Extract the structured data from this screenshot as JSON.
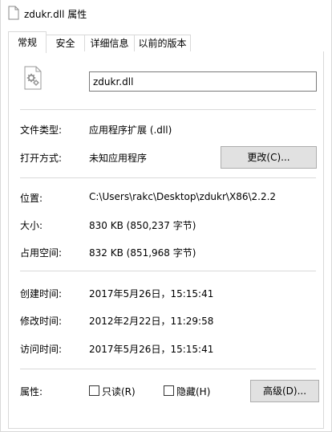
{
  "window": {
    "title": "zdukr.dll 属性",
    "title_icon": "document-icon"
  },
  "tabs": [
    {
      "label": "常规",
      "active": true
    },
    {
      "label": "安全",
      "active": false
    },
    {
      "label": "详细信息",
      "active": false
    },
    {
      "label": "以前的版本",
      "active": false
    }
  ],
  "general": {
    "file_icon": "settings-file-icon",
    "filename": "zdukr.dll",
    "file_type_label": "文件类型:",
    "file_type_value": "应用程序扩展 (.dll)",
    "open_with_label": "打开方式:",
    "open_with_value": "未知应用程序",
    "change_button": "更改(C)...",
    "location_label": "位置:",
    "location_value": "C:\\Users\\rakc\\Desktop\\zdukr\\X86\\2.2.2",
    "size_label": "大小:",
    "size_value": "830 KB (850,237 字节)",
    "size_on_disk_label": "占用空间:",
    "size_on_disk_value": "832 KB (851,968 字节)",
    "created_label": "创建时间:",
    "created_value": "2017年5月26日，15:15:41",
    "modified_label": "修改时间:",
    "modified_value": "2012年2月22日，11:29:58",
    "accessed_label": "访问时间:",
    "accessed_value": "2017年5月26日，15:15:41",
    "attributes_label": "属性:",
    "readonly_label": "只读(R)",
    "readonly_checked": false,
    "hidden_label": "隐藏(H)",
    "hidden_checked": false,
    "advanced_button": "高级(D)..."
  }
}
